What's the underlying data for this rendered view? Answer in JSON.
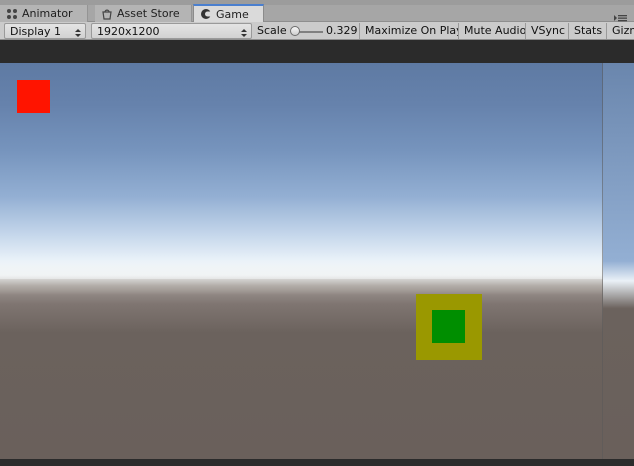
{
  "tabs": [
    {
      "label": "Animator",
      "icon": "animator-icon",
      "active": false
    },
    {
      "label": "Asset Store",
      "icon": "asset-store-icon",
      "active": false
    },
    {
      "label": "Game",
      "icon": "game-controller-icon",
      "active": true
    }
  ],
  "toolbar": {
    "display": "Display 1",
    "resolution": "1920x1200",
    "scale_label": "Scale",
    "scale_value": "0.329",
    "scale_fraction": 0.0,
    "maximize_on_play": "Maximize On Play",
    "mute_audio": "Mute Audio",
    "vsync": "VSync",
    "stats": "Stats",
    "gizmos": "Gizmos"
  },
  "scene": {
    "red_square_color": "#ff1400",
    "yellow_frame_color": "#9a9800",
    "green_square_color": "#008e00",
    "sky_top_color": "#5e7aa3",
    "ground_color": "#6a605b",
    "accent_tab_color": "#4a7fcf"
  }
}
